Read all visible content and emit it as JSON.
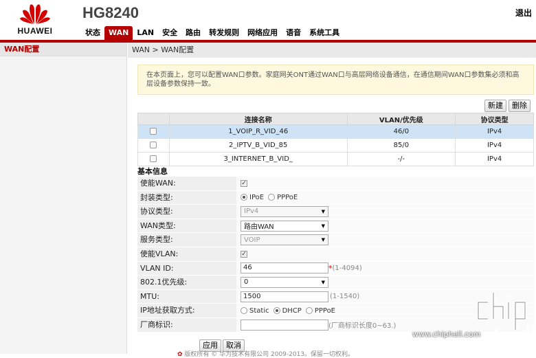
{
  "header": {
    "brand": "HUAWEI",
    "model": "HG8240",
    "logout_label": "退出",
    "nav": [
      "状态",
      "WAN",
      "LAN",
      "安全",
      "路由",
      "转发规则",
      "网络应用",
      "语音",
      "系统工具"
    ],
    "active_nav": "WAN",
    "accent_color": "#b40000"
  },
  "sidebar": {
    "items": [
      {
        "label": "WAN配置"
      }
    ]
  },
  "breadcrumb": "WAN > WAN配置",
  "notice": "在本页面上，您可以配置WAN口参数。家庭网关ONT通过WAN口与高层网络设备通信，在通信期间WAN口参数集必须和高层设备参数保持一致。",
  "toolbar": {
    "new_label": "新建",
    "delete_label": "删除"
  },
  "table": {
    "headers": [
      "",
      "连接名称",
      "VLAN/优先级",
      "协议类型"
    ],
    "rows": [
      {
        "name": "1_VOIP_R_VID_46",
        "vlan": "46/0",
        "protocol": "IPv4"
      },
      {
        "name": "2_IPTV_B_VID_85",
        "vlan": "85/0",
        "protocol": "IPv4"
      },
      {
        "name": "3_INTERNET_B_VID_",
        "vlan": "-/-",
        "protocol": "IPv4"
      }
    ]
  },
  "form": {
    "section_title": "基本信息",
    "labels": {
      "enable_wan": "使能WAN:",
      "encap": "封装类型:",
      "protocol": "协议类型:",
      "wan_type": "WAN类型:",
      "service": "服务类型:",
      "enable_vlan": "使能VLAN:",
      "vlan_id": "VLAN ID:",
      "priority": "802.1优先级:",
      "mtu": "MTU:",
      "ip_mode": "IP地址获取方式:",
      "vendor": "厂商标识:"
    },
    "encap_options": [
      "IPoE",
      "PPPoE"
    ],
    "protocol_value": "IPv4",
    "wan_type_value": "路由WAN",
    "service_value": "VOIP",
    "vlan_id_value": "46",
    "vlan_id_req": "*",
    "vlan_id_hint": "(1-4094)",
    "priority_value": "0",
    "mtu_value": "1500",
    "mtu_hint": "(1-1540)",
    "ip_mode_options": [
      "Static",
      "DHCP",
      "PPPoE"
    ],
    "vendor_value": "",
    "vendor_hint": "(厂商标识长度0~63.)"
  },
  "actions": {
    "apply_label": "应用",
    "cancel_label": "取消"
  },
  "footer": "版权所有 © 华为技术有限公司 2009-2013。保留一切权利。",
  "watermark": "www.chiphell.com"
}
